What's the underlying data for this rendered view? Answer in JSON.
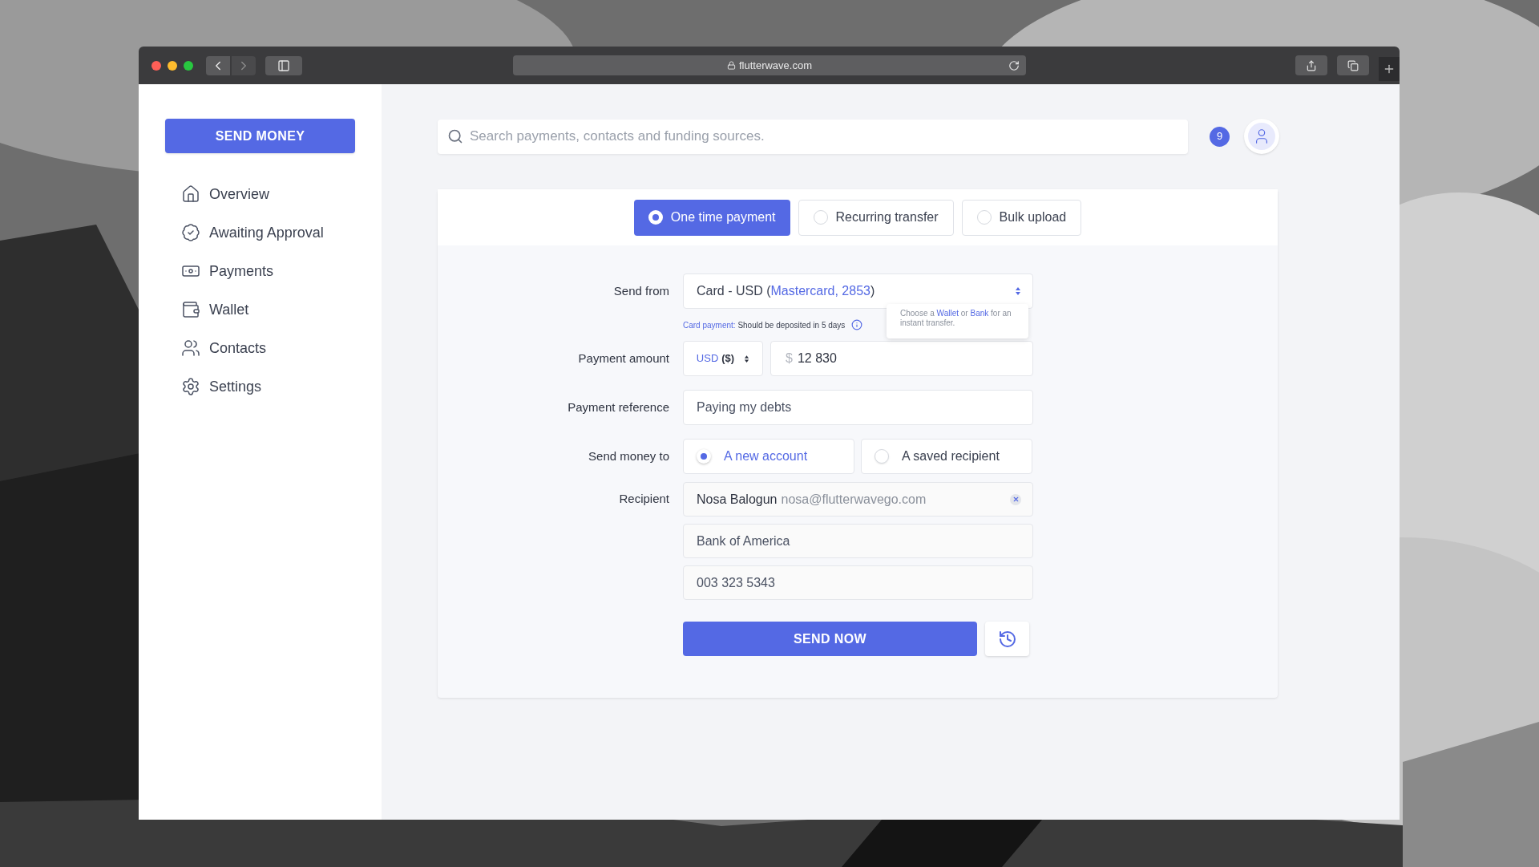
{
  "browser": {
    "url": "flutterwave.com"
  },
  "sidebar": {
    "action": "SEND MONEY",
    "items": [
      {
        "label": "Overview",
        "kind": "home"
      },
      {
        "label": "Awaiting Approval",
        "kind": "approval"
      },
      {
        "label": "Payments",
        "kind": "payments"
      },
      {
        "label": "Wallet",
        "kind": "wallet"
      },
      {
        "label": "Contacts",
        "kind": "contacts"
      },
      {
        "label": "Settings",
        "kind": "settings"
      }
    ]
  },
  "search": {
    "placeholder": "Search payments, contacts and funding sources."
  },
  "notifications": {
    "count": "9"
  },
  "tabs": [
    {
      "label": "One time payment",
      "selected": true
    },
    {
      "label": "Recurring transfer",
      "selected": false
    },
    {
      "label": "Bulk upload",
      "selected": false
    }
  ],
  "form": {
    "send_from": {
      "label": "Send from",
      "value_prefix": "Card - USD (",
      "value_link": "Mastercard, 2853",
      "value_suffix": ")",
      "hint_label": "Card payment:",
      "hint_text": "Should be deposited in 5 days"
    },
    "tooltip": {
      "parts": [
        "Choose a ",
        "Wallet",
        " or ",
        "Bank",
        " for an instant transfer."
      ]
    },
    "amount": {
      "label": "Payment amount",
      "currency_code": "USD",
      "currency_symbol": "($)",
      "prefix": "$",
      "value": "12 830"
    },
    "reference": {
      "label": "Payment reference",
      "value": "Paying my debts"
    },
    "send_to": {
      "label": "Send money to",
      "options": [
        {
          "label": "A new account",
          "selected": true
        },
        {
          "label": "A saved recipient",
          "selected": false
        }
      ]
    },
    "recipient": {
      "label": "Recipient",
      "name": "Nosa Balogun",
      "email": "nosa@flutterwavego.com",
      "bank": "Bank of America",
      "account": "003 323 5343"
    },
    "submit": "SEND NOW"
  }
}
